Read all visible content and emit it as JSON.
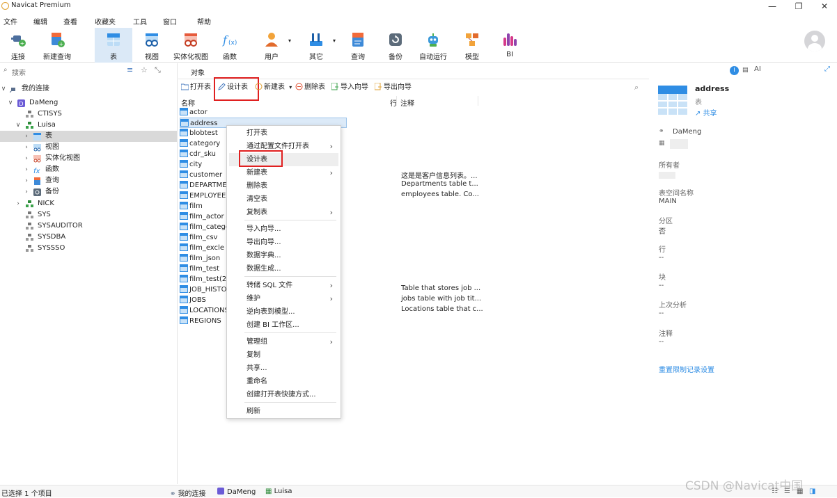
{
  "window": {
    "title": "Navicat Premium",
    "minimize": "—",
    "maximize": "❐",
    "close": "✕"
  },
  "menu": [
    "文件",
    "编辑",
    "查看",
    "收藏夹",
    "工具",
    "窗口",
    "帮助"
  ],
  "toolbar": [
    {
      "label": "连接",
      "icon": "plug-icon"
    },
    {
      "label": "新建查询",
      "icon": "new-query-icon"
    },
    {
      "label": "表",
      "icon": "table-icon"
    },
    {
      "label": "视图",
      "icon": "view-icon"
    },
    {
      "label": "实体化视图",
      "icon": "materialized-view-icon"
    },
    {
      "label": "函数",
      "icon": "function-icon"
    },
    {
      "label": "用户",
      "icon": "user-icon"
    },
    {
      "label": "其它",
      "icon": "other-icon"
    },
    {
      "label": "查询",
      "icon": "query-icon"
    },
    {
      "label": "备份",
      "icon": "backup-icon"
    },
    {
      "label": "自动运行",
      "icon": "robot-icon"
    },
    {
      "label": "模型",
      "icon": "model-icon"
    },
    {
      "label": "BI",
      "icon": "bi-icon"
    }
  ],
  "sidebar": {
    "search_placeholder": "搜索",
    "tree": [
      {
        "label": "我的连接"
      },
      {
        "label": "DaMeng"
      },
      {
        "label": "CTISYS"
      },
      {
        "label": "Luisa"
      },
      {
        "label": "表"
      },
      {
        "label": "视图"
      },
      {
        "label": "实体化视图"
      },
      {
        "label": "函数"
      },
      {
        "label": "查询"
      },
      {
        "label": "备份"
      },
      {
        "label": "NICK"
      },
      {
        "label": "SYS"
      },
      {
        "label": "SYSAUDITOR"
      },
      {
        "label": "SYSDBA"
      },
      {
        "label": "SYSSSO"
      }
    ]
  },
  "center": {
    "tab": "对象",
    "toolbar": {
      "open": "打开表",
      "design": "设计表",
      "new": "新建表",
      "delete": "删除表",
      "import": "导入向导",
      "export": "导出向导"
    },
    "columns": {
      "name": "名称",
      "rows": "行",
      "comment": "注释"
    },
    "tables": [
      {
        "name": "actor",
        "comment": ""
      },
      {
        "name": "address",
        "comment": ""
      },
      {
        "name": "blobtest",
        "comment": ""
      },
      {
        "name": "category",
        "comment": ""
      },
      {
        "name": "cdr_sku",
        "comment": ""
      },
      {
        "name": "city",
        "comment": ""
      },
      {
        "name": "customer",
        "comment": "这是是客户信息列表。..."
      },
      {
        "name": "DEPARTME",
        "comment": "Departments table t..."
      },
      {
        "name": "EMPLOYEE",
        "comment": "employees table. Co..."
      },
      {
        "name": "film",
        "comment": ""
      },
      {
        "name": "film_actor",
        "comment": ""
      },
      {
        "name": "film_catego",
        "comment": ""
      },
      {
        "name": "film_csv",
        "comment": ""
      },
      {
        "name": "film_excle",
        "comment": ""
      },
      {
        "name": "film_json",
        "comment": ""
      },
      {
        "name": "film_test",
        "comment": ""
      },
      {
        "name": "film_test(2)",
        "comment": ""
      },
      {
        "name": "JOB_HISTO",
        "comment": "Table that stores job ..."
      },
      {
        "name": "JOBS",
        "comment": "jobs table with job tit..."
      },
      {
        "name": "LOCATIONS",
        "comment": "Locations table that c..."
      },
      {
        "name": "REGIONS",
        "comment": ""
      }
    ]
  },
  "context_menu": [
    {
      "label": "打开表",
      "sub": false
    },
    {
      "label": "通过配置文件打开表",
      "sub": true
    },
    {
      "label": "设计表",
      "sub": false
    },
    {
      "label": "新建表",
      "sub": true
    },
    {
      "label": "删除表",
      "sub": false
    },
    {
      "label": "清空表",
      "sub": false
    },
    {
      "label": "复制表",
      "sub": true
    },
    {
      "label": "导入向导...",
      "sub": false
    },
    {
      "label": "导出向导...",
      "sub": false
    },
    {
      "label": "数据字典...",
      "sub": false
    },
    {
      "label": "数据生成...",
      "sub": false
    },
    {
      "label": "转储 SQL 文件",
      "sub": true
    },
    {
      "label": "维护",
      "sub": true
    },
    {
      "label": "逆向表到模型...",
      "sub": false
    },
    {
      "label": "创建 BI 工作区...",
      "sub": false
    },
    {
      "label": "管理组",
      "sub": true
    },
    {
      "label": "复制",
      "sub": false
    },
    {
      "label": "共享...",
      "sub": false
    },
    {
      "label": "重命名",
      "sub": false
    },
    {
      "label": "创建打开表快捷方式...",
      "sub": false
    },
    {
      "label": "刷新",
      "sub": false
    }
  ],
  "right_panel": {
    "name": "address",
    "type": "表",
    "share": "共享",
    "connection": "DaMeng",
    "owner_label": "所有者",
    "tablespace_label": "表空间名称",
    "tablespace_value": "MAIN",
    "partition_label": "分区",
    "partition_value": "否",
    "rows_label": "行",
    "rows_value": "--",
    "blocks_label": "块",
    "blocks_value": "--",
    "analyzed_label": "上次分析",
    "analyzed_value": "--",
    "comment_label": "注释",
    "comment_value": "--",
    "reset_link": "重置限制记录设置"
  },
  "status": {
    "selection": "已选择 1 个项目",
    "crumb1": "我的连接",
    "crumb2": "DaMeng",
    "crumb3": "Luisa"
  },
  "watermark": "CSDN @Navicat中国"
}
